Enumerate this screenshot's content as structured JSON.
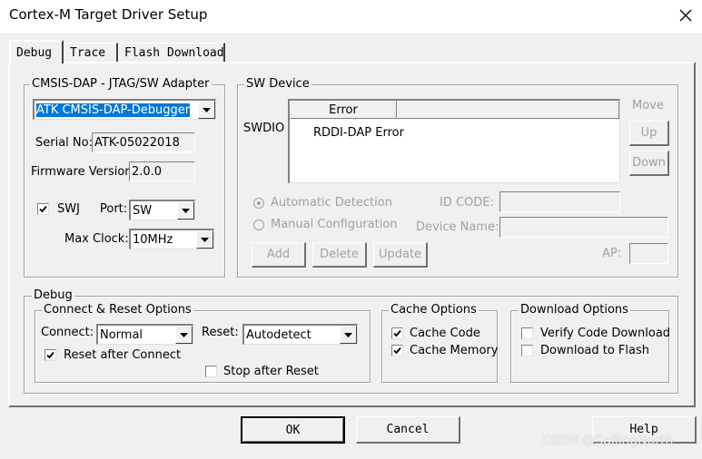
{
  "window": {
    "title": "Cortex-M Target Driver Setup"
  },
  "tabs": [
    {
      "label": "Debug",
      "active": true
    },
    {
      "label": "Trace",
      "active": false
    },
    {
      "label": "Flash Download",
      "active": false
    }
  ],
  "adapter": {
    "legend": "CMSIS-DAP - JTAG/SW Adapter",
    "selected": "ATK CMSIS-DAP-Debugger",
    "serial_label": "Serial No:",
    "serial_value": "ATK-05022018",
    "firmware_label": "Firmware Version:",
    "firmware_value": "2.0.0",
    "swj_label": "SWJ",
    "swj_checked": true,
    "port_label": "Port:",
    "port_value": "SW",
    "clock_label": "Max Clock:",
    "clock_value": "10MHz"
  },
  "sw_device": {
    "legend": "SW Device",
    "swdio_label": "SWDIO",
    "column_header": "Error",
    "row_text": "RDDI-DAP Error",
    "move_label": "Move",
    "up_label": "Up",
    "down_label": "Down",
    "auto_detect_label": "Automatic Detection",
    "manual_config_label": "Manual Configuration",
    "id_code_label": "ID CODE:",
    "device_name_label": "Device Name:",
    "add_label": "Add",
    "delete_label": "Delete",
    "update_label": "Update",
    "ap_label": "AP:"
  },
  "debug": {
    "legend": "Debug",
    "connect_reset": {
      "legend": "Connect & Reset Options",
      "connect_label": "Connect:",
      "connect_value": "Normal",
      "reset_label": "Reset:",
      "reset_value": "Autodetect",
      "reset_after_connect_label": "Reset after Connect",
      "reset_after_connect_checked": true,
      "stop_after_reset_label": "Stop after Reset",
      "stop_after_reset_checked": false
    },
    "cache": {
      "legend": "Cache Options",
      "cache_code_label": "Cache Code",
      "cache_code_checked": true,
      "cache_memory_label": "Cache Memory",
      "cache_memory_checked": true
    },
    "download": {
      "legend": "Download Options",
      "verify_label": "Verify Code Download",
      "verify_checked": false,
      "flash_label": "Download to Flash",
      "flash_checked": false
    }
  },
  "buttons": {
    "ok": "OK",
    "cancel": "Cancel",
    "help": "Help"
  },
  "watermark": "CSDN @SailingNorth"
}
